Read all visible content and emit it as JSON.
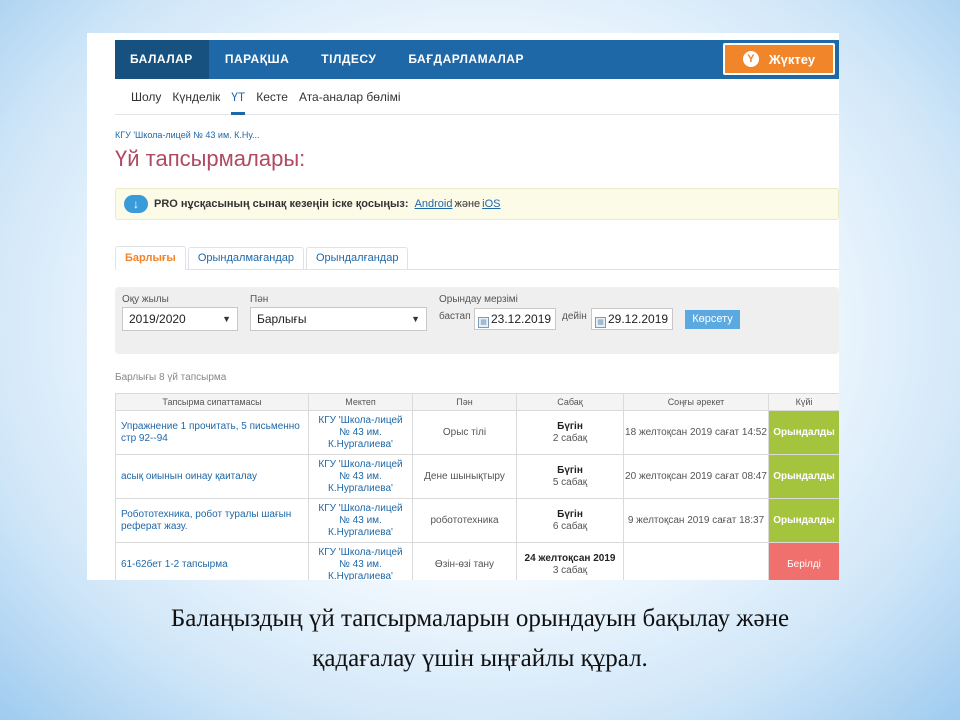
{
  "nav": {
    "tabs": [
      "БАЛАЛАР",
      "ПАРАҚША",
      "ТІЛДЕСУ",
      "БАҒДАРЛАМАЛАР"
    ],
    "download_label": "Жүктеу"
  },
  "subnav": [
    "Шолу",
    "Күнделік",
    "ҮТ",
    "Кесте",
    "Ата-аналар бөлімі"
  ],
  "breadcrumb": "КГУ 'Школа-лицей № 43 им. К.Ну...",
  "page_title": "Үй тапсырмалары:",
  "promo": {
    "text": "PRO нұсқасының сынақ кезеңін іске қосыңыз:",
    "android": "Android",
    "and": "және",
    "ios": "iOS"
  },
  "tabs": [
    "Барлығы",
    "Орындалмағандар",
    "Орындалғандар"
  ],
  "filters": {
    "year_label": "Оқу жылы",
    "year_value": "2019/2020",
    "subject_label": "Пән",
    "subject_value": "Барлығы",
    "deadline_label": "Орындау мерзімі",
    "from_label": "бастап",
    "from_value": "23.12.2019",
    "to_label": "дейін",
    "to_value": "29.12.2019",
    "show_button": "Көрсету"
  },
  "count_text": "Барлығы 8 үй тапсырма",
  "table": {
    "headers": [
      "Тапсырма сипаттамасы",
      "Мектеп",
      "Пән",
      "Сабақ",
      "Соңғы әрекет",
      "Күйі"
    ],
    "rows": [
      {
        "desc": "Упражнение 1 прочитать, 5 письменно стр 92--94",
        "school": [
          "КГУ 'Школа-лицей",
          "№ 43 им.",
          "К.Нургалиева'"
        ],
        "subject": "Орыс тілі",
        "lesson_day": "Бүгін",
        "lesson_num": "2 сабақ",
        "last_action": "18 желтоқсан 2019 сағат 14:52",
        "status": "Орындалды"
      },
      {
        "desc": "асық оиынын оинау қаиталау",
        "school": [
          "КГУ 'Школа-лицей",
          "№ 43 им.",
          "К.Нургалиева'"
        ],
        "subject": "Дене шынықтыру",
        "lesson_day": "Бүгін",
        "lesson_num": "5 сабақ",
        "last_action": "20 желтоқсан 2019 сағат 08:47",
        "status": "Орындалды"
      },
      {
        "desc": "Робототехника, робот туралы шағын реферат жазу.",
        "school": [
          "КГУ 'Школа-лицей",
          "№ 43 им.",
          "К.Нургалиева'"
        ],
        "subject": "робототехника",
        "lesson_day": "Бүгін",
        "lesson_num": "6 сабақ",
        "last_action": "9 желтоқсан 2019 сағат 18:37",
        "status": "Орындалды"
      },
      {
        "desc": "61-62бет 1-2 тапсырма",
        "school": [
          "КГУ 'Школа-лицей",
          "№ 43 им.",
          "К.Нургалиева'"
        ],
        "subject": "Өзін-өзі тану",
        "lesson_day": "24 желтоқсан 2019",
        "lesson_num": "3 сабақ",
        "last_action": "",
        "status": "Берілді"
      }
    ]
  },
  "caption": {
    "line1": "Балаңыздың үй тапсырмаларын орындауын бақылау және",
    "line2": "қадағалау үшін ыңғайлы құрал."
  },
  "colors": {
    "nav_blue": "#1f68a8",
    "accent_orange": "#f0852a",
    "title_pink": "#b04a64",
    "status_done": "#a5c43e",
    "status_given": "#f0706d"
  }
}
